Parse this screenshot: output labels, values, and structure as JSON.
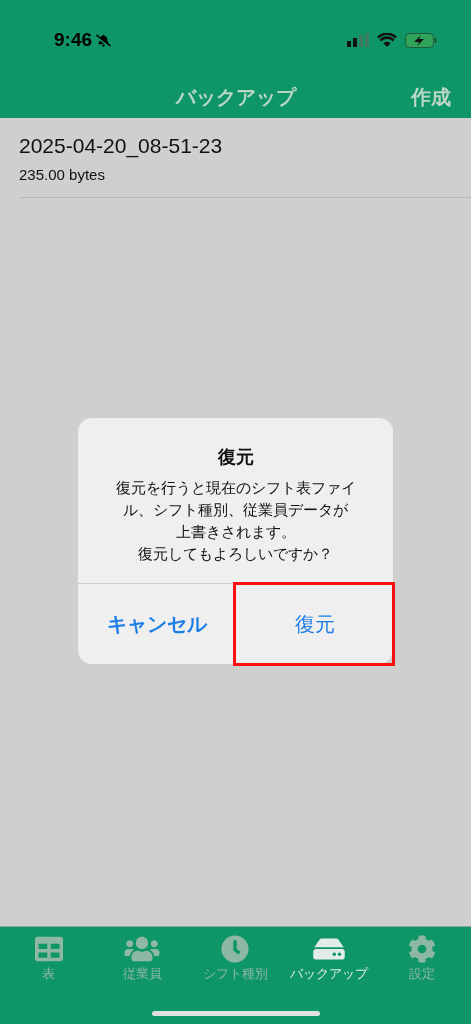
{
  "status_bar": {
    "time": "9:46"
  },
  "nav": {
    "title": "バックアップ",
    "action": "作成"
  },
  "backups": [
    {
      "name": "2025-04-20_08-51-23",
      "size": "235.00 bytes"
    }
  ],
  "dialog": {
    "title": "復元",
    "message_lines": [
      "復元を行うと現在のシフト表ファイル、シフト種別、従業員データが",
      "上書きされます。",
      "復元してもよろしいですか？"
    ],
    "actions": [
      {
        "label": "キャンセル",
        "kind": "cancel",
        "highlighted": false
      },
      {
        "label": "復元",
        "kind": "default",
        "highlighted": true
      }
    ]
  },
  "tabs": [
    {
      "label": "表",
      "kind": "table",
      "selected": false
    },
    {
      "label": "従業員",
      "kind": "people",
      "selected": false
    },
    {
      "label": "シフト種別",
      "kind": "clock",
      "selected": false
    },
    {
      "label": "バックアップ",
      "kind": "drive",
      "selected": true
    },
    {
      "label": "設定",
      "kind": "gear",
      "selected": false
    }
  ]
}
